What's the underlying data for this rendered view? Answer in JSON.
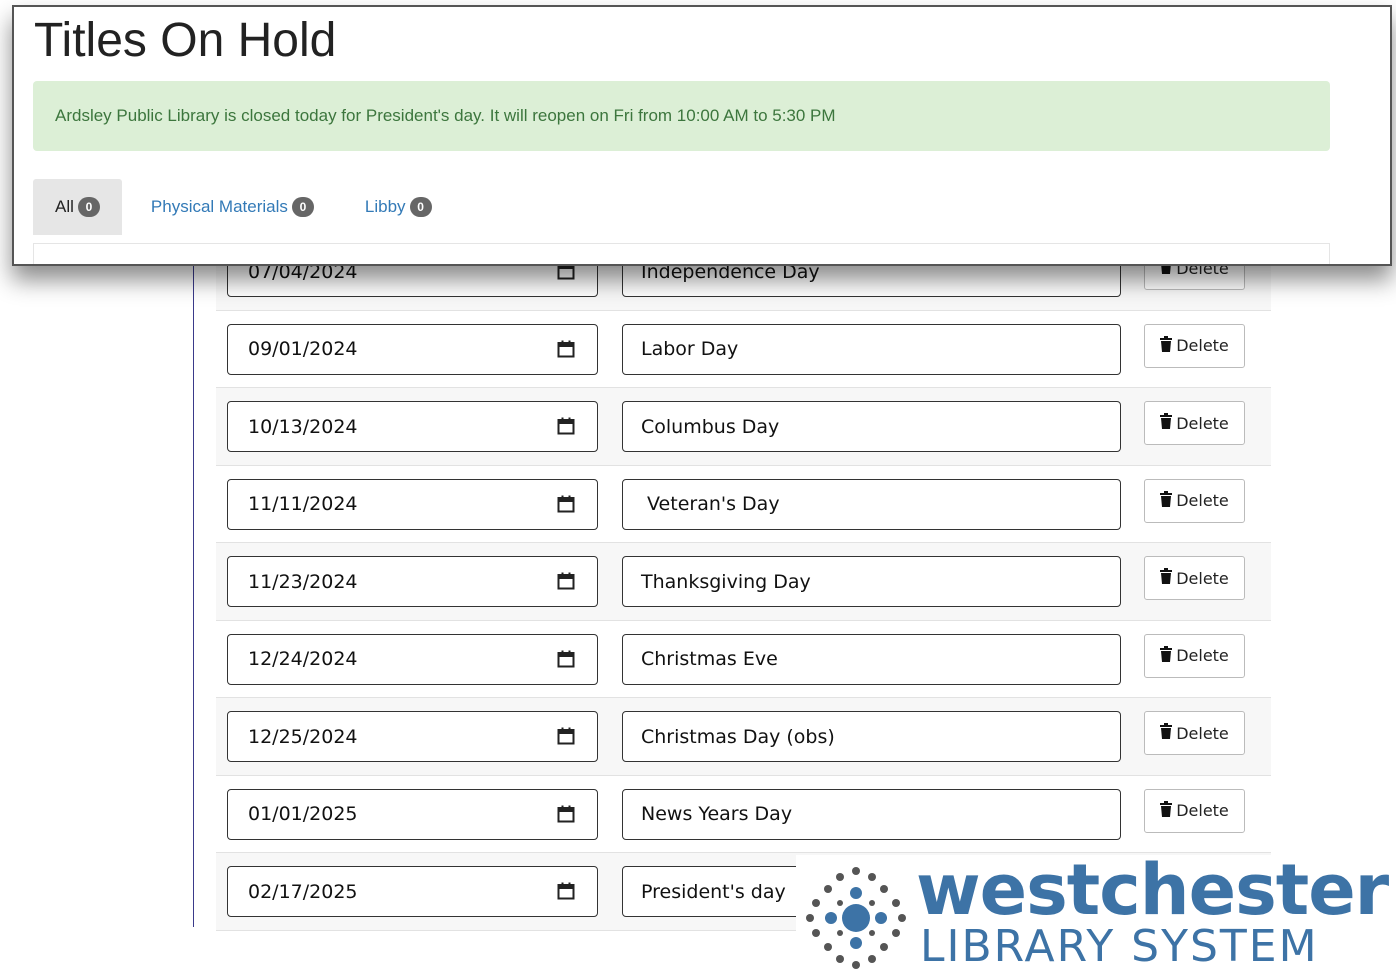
{
  "popup": {
    "title": "Titles On Hold",
    "alert": "Ardsley Public Library is closed today for President's day. It will reopen on Fri from 10:00 AM to 5:30 PM",
    "tabs": [
      {
        "label": "All",
        "count": "0",
        "active": true
      },
      {
        "label": "Physical Materials",
        "count": "0",
        "active": false
      },
      {
        "label": "Libby",
        "count": "0",
        "active": false
      }
    ]
  },
  "holidays": {
    "delete_label": "Delete",
    "rows": [
      {
        "date": "07/04/2024",
        "name": "Independence Day"
      },
      {
        "date": "09/01/2024",
        "name": "Labor Day"
      },
      {
        "date": "10/13/2024",
        "name": "Columbus Day"
      },
      {
        "date": "11/11/2024",
        "name": " Veteran's Day"
      },
      {
        "date": "11/23/2024",
        "name": "Thanksgiving Day"
      },
      {
        "date": "12/24/2024",
        "name": "Christmas Eve"
      },
      {
        "date": "12/25/2024",
        "name": "Christmas Day (obs)"
      },
      {
        "date": "01/01/2025",
        "name": "News Years Day"
      },
      {
        "date": "02/17/2025",
        "name": "President's day"
      }
    ]
  },
  "logo": {
    "line1": "westchester",
    "line2": "LIBRARY SYSTEM",
    "color": "#3d73a6",
    "icon": "westchester-logo-mark"
  }
}
